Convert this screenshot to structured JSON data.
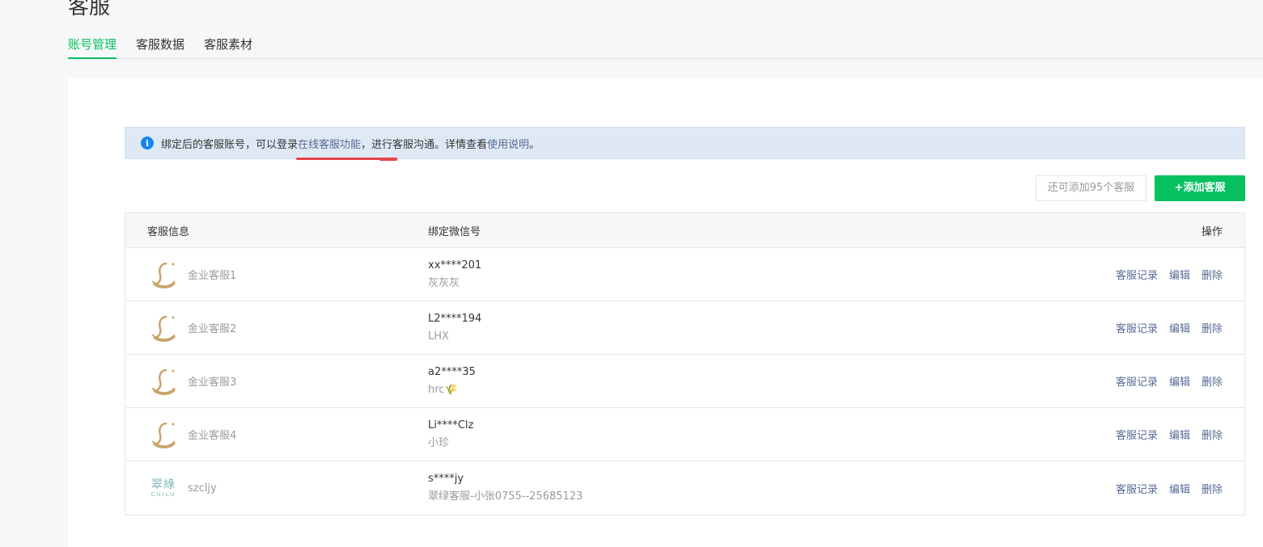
{
  "page": {
    "title": "客服"
  },
  "tabs": [
    {
      "label": "账号管理",
      "active": true
    },
    {
      "label": "客服数据",
      "active": false
    },
    {
      "label": "客服素材",
      "active": false
    }
  ],
  "notice": {
    "icon": "info-icon",
    "prefix": "绑定后的客服账号，可以登录",
    "link1": "在线客服功能",
    "middle": "，进行客服沟通。详情查看",
    "link2": "使用说明",
    "suffix": "。"
  },
  "toolbar": {
    "remaining": "还可添加95个客服",
    "add_label": "+添加客服"
  },
  "table": {
    "headers": {
      "info": "客服信息",
      "wechat": "绑定微信号",
      "actions": "操作"
    },
    "rows": [
      {
        "avatar": "L-logo",
        "name": "金业客服1",
        "wechat": "xx****201",
        "nickname": "灰灰灰"
      },
      {
        "avatar": "L-logo",
        "name": "金业客服2",
        "wechat": "L2****194",
        "nickname": "LHX"
      },
      {
        "avatar": "L-logo",
        "name": "金业客服3",
        "wechat": "a2****35",
        "nickname": "hrc🌾"
      },
      {
        "avatar": "L-logo",
        "name": "金业客服4",
        "wechat": "Li****Clz",
        "nickname": "小珍"
      },
      {
        "avatar": "cuilu-logo",
        "name": "szcljy",
        "wechat": "s****jy",
        "nickname": "翠绿客服-小张0755--25685123"
      }
    ],
    "actions": {
      "record": "客服记录",
      "edit": "编辑",
      "delete": "删除"
    }
  },
  "logo_cuilu": {
    "cn": "翠綠",
    "en": "CUILU"
  },
  "colors": {
    "accent": "#07c160",
    "link": "#576b95",
    "notice_bg": "#dfe9f5",
    "logo_gold": "#c9a46b"
  }
}
